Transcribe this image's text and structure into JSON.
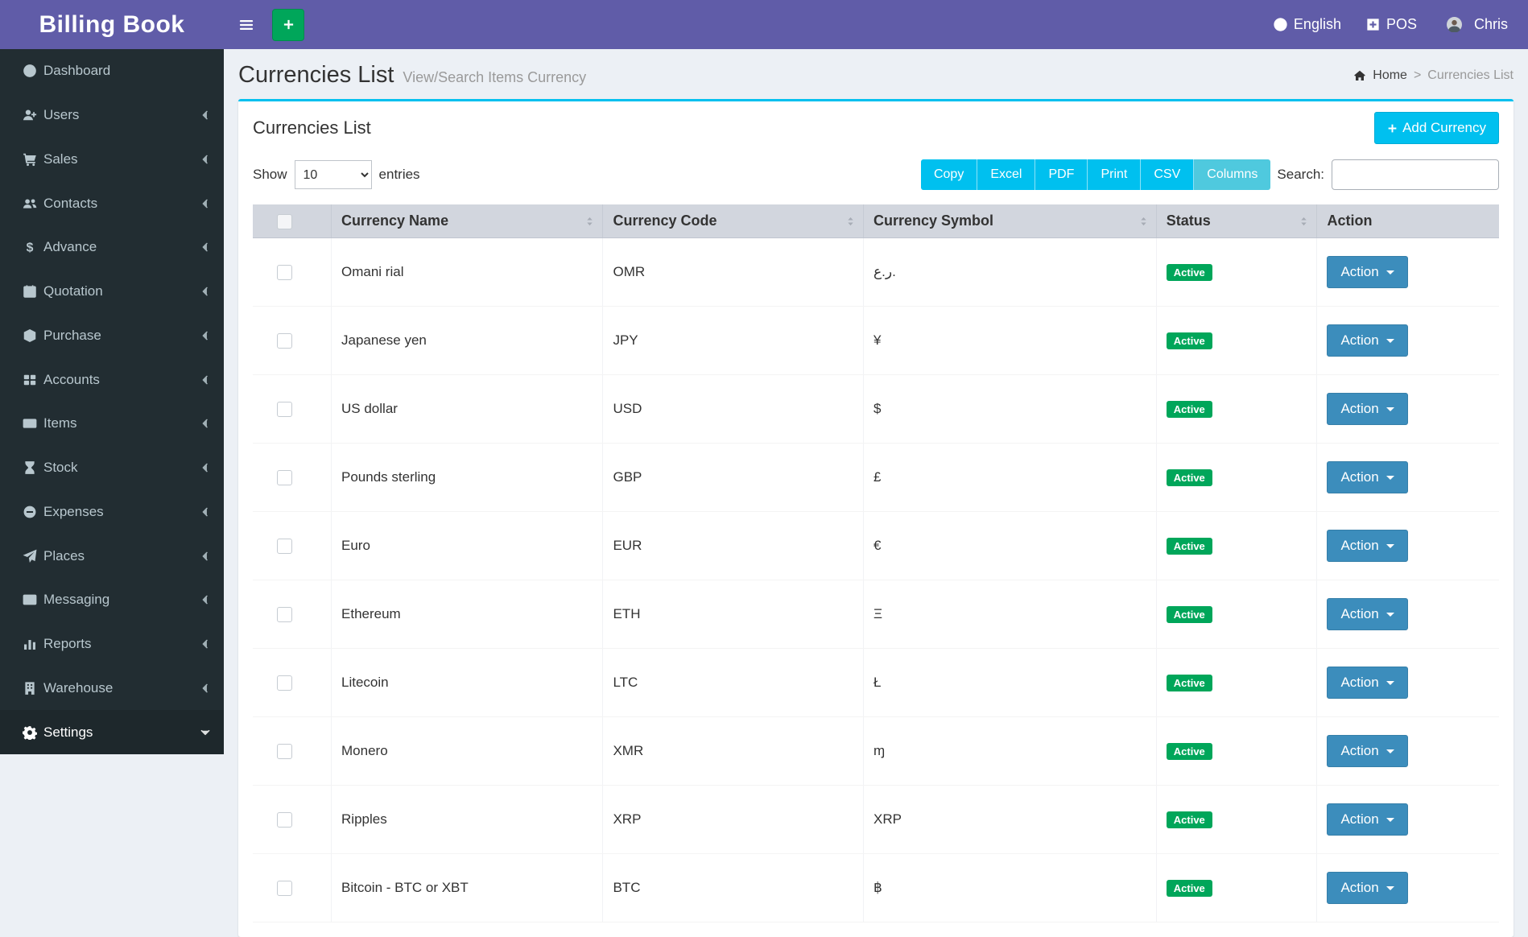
{
  "app": {
    "title": "Billing Book"
  },
  "topbar": {
    "language": "English",
    "pos_label": "POS",
    "user_name": "Chris"
  },
  "sidebar": {
    "items": [
      {
        "label": "Dashboard",
        "icon": "dashboard-icon",
        "expandable": false,
        "active": false
      },
      {
        "label": "Users",
        "icon": "users-icon",
        "expandable": true,
        "active": false
      },
      {
        "label": "Sales",
        "icon": "sales-icon",
        "expandable": true,
        "active": false
      },
      {
        "label": "Contacts",
        "icon": "contacts-icon",
        "expandable": true,
        "active": false
      },
      {
        "label": "Advance",
        "icon": "advance-icon",
        "expandable": true,
        "active": false
      },
      {
        "label": "Quotation",
        "icon": "quotation-icon",
        "expandable": true,
        "active": false
      },
      {
        "label": "Purchase",
        "icon": "purchase-icon",
        "expandable": true,
        "active": false
      },
      {
        "label": "Accounts",
        "icon": "accounts-icon",
        "expandable": true,
        "active": false
      },
      {
        "label": "Items",
        "icon": "items-icon",
        "expandable": true,
        "active": false
      },
      {
        "label": "Stock",
        "icon": "stock-icon",
        "expandable": true,
        "active": false
      },
      {
        "label": "Expenses",
        "icon": "expenses-icon",
        "expandable": true,
        "active": false
      },
      {
        "label": "Places",
        "icon": "places-icon",
        "expandable": true,
        "active": false
      },
      {
        "label": "Messaging",
        "icon": "messaging-icon",
        "expandable": true,
        "active": false
      },
      {
        "label": "Reports",
        "icon": "reports-icon",
        "expandable": true,
        "active": false
      },
      {
        "label": "Warehouse",
        "icon": "warehouse-icon",
        "expandable": true,
        "active": false
      },
      {
        "label": "Settings",
        "icon": "settings-icon",
        "expandable": true,
        "active": true,
        "open": true
      }
    ]
  },
  "page": {
    "title": "Currencies List",
    "subtitle": "View/Search Items Currency",
    "breadcrumb": {
      "home": "Home",
      "separator": ">",
      "current": "Currencies List"
    }
  },
  "card": {
    "title": "Currencies List",
    "add_button_label": "Add Currency"
  },
  "controls": {
    "show_label": "Show",
    "entries_selected": "10",
    "entries_label": "entries",
    "export_buttons": [
      {
        "label": "Copy",
        "active": false
      },
      {
        "label": "Excel",
        "active": false
      },
      {
        "label": "PDF",
        "active": false
      },
      {
        "label": "Print",
        "active": false
      },
      {
        "label": "CSV",
        "active": false
      },
      {
        "label": "Columns",
        "active": true
      }
    ],
    "search_label": "Search:",
    "search_value": ""
  },
  "table": {
    "columns": [
      {
        "label": "",
        "sortable": false
      },
      {
        "label": "Currency Name",
        "sortable": true
      },
      {
        "label": "Currency Code",
        "sortable": true
      },
      {
        "label": "Currency Symbol",
        "sortable": true
      },
      {
        "label": "Status",
        "sortable": true
      },
      {
        "label": "Action",
        "sortable": false
      }
    ],
    "action_button_label": "Action",
    "rows": [
      {
        "name": "Omani rial",
        "code": "OMR",
        "symbol": "ر.ع.",
        "status": "Active"
      },
      {
        "name": "Japanese yen",
        "code": "JPY",
        "symbol": "¥",
        "status": "Active"
      },
      {
        "name": "US dollar",
        "code": "USD",
        "symbol": "$",
        "status": "Active"
      },
      {
        "name": "Pounds sterling",
        "code": "GBP",
        "symbol": "£",
        "status": "Active"
      },
      {
        "name": "Euro",
        "code": "EUR",
        "symbol": "€",
        "status": "Active"
      },
      {
        "name": "Ethereum",
        "code": "ETH",
        "symbol": "Ξ",
        "status": "Active"
      },
      {
        "name": "Litecoin",
        "code": "LTC",
        "symbol": "Ł",
        "status": "Active"
      },
      {
        "name": "Monero",
        "code": "XMR",
        "symbol": "ɱ",
        "status": "Active"
      },
      {
        "name": "Ripples",
        "code": "XRP",
        "symbol": "XRP",
        "status": "Active"
      },
      {
        "name": "Bitcoin - BTC or XBT",
        "code": "BTC",
        "symbol": "฿",
        "status": "Active"
      }
    ]
  },
  "colors": {
    "navbar": "#605ca8",
    "sidebar": "#222d32",
    "sidebar_active": "#1e282c",
    "accent_green": "#00a65a",
    "accent_info": "#00c0ef",
    "accent_info_active": "#4fc9de",
    "accent_primary": "#3c8dbc",
    "content_bg": "#ecf0f5"
  }
}
